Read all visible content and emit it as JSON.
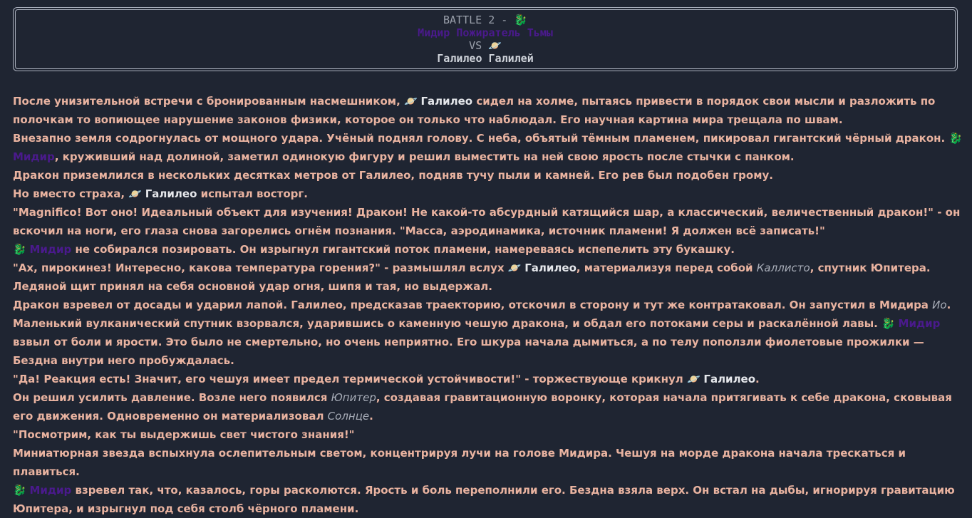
{
  "header": {
    "battle_label": "BATTLE 2 - ",
    "dragon_icon": "🐉",
    "fighter1": "Мидир Пожиратель Тьмы",
    "vs": "VS ",
    "planet_icon": "🪐",
    "fighter2": "Галилео Галилей"
  },
  "story": {
    "p1": [
      "После унизительной встречи с бронированным насмешником, ",
      "Галилео",
      " сидел на холме, пытаясь привести в порядок свои мысли и разложить по полочкам то вопиющее нарушение законов физики, которое он только что наблюдал. Его научная картина мира трещала по швам."
    ],
    "p2": [
      "Внезапно земля содрогнулась от мощного удара. Учёный поднял голову. С неба, объятый тёмным пламенем, пикировал гигантский чёрный дракон. ",
      "Мидир",
      ", круживший над долиной, заметил одинокую фигуру и решил выместить на ней свою ярость после стычки с панком."
    ],
    "p3": "Дракон приземлился в нескольких десятках метров от Галилео, подняв тучу пыли и камней. Его рев был подобен грому.",
    "p4": [
      "Но вместо страха, ",
      "Галилео",
      " испытал восторг."
    ],
    "p5": "\"Magnifico! Вот оно! Идеальный объект для изучения! Дракон! Не какой-то абсурдный катящийся шар, а классический, величественный дракон!\" - он вскочил на ноги, его глаза снова загорелись огнём познания. \"Масса, аэродинамика, источник пламени! Я должен всё записать!\"",
    "p6": [
      "Мидир",
      " не собирался позировать. Он изрыгнул гигантский поток пламени, намереваясь испепелить эту букашку."
    ],
    "p7": [
      "\"Ах, пирокинез! Интересно, какова температура горения?\" - размышлял вслух ",
      "Галилео",
      ", материализуя перед собой ",
      "Каллисто",
      ", спутник Юпитера. Ледяной щит принял на себя основной удар огня, шипя и тая, но выдержал."
    ],
    "p8": [
      "Дракон взревел от досады и ударил лапой. Галилео, предсказав траекторию, отскочил в сторону и тут же контратаковал. Он запустил в Мидира ",
      "Ио",
      ". Маленький вулканический спутник взорвался, ударившись о каменную чешую дракона, и обдал его потоками серы и раскалённой лавы. ",
      "Мидир",
      " взвыл от боли и ярости. Это было не смертельно, но очень неприятно. Его шкура начала дымиться, а по телу поползли фиолетовые прожилки — Бездна внутри него пробуждалась."
    ],
    "p9": [
      "\"Да! Реакция есть! Значит, его чешуя имеет предел термической устойчивости!\" - торжествующе крикнул ",
      "Галилео",
      "."
    ],
    "p10": [
      "Он решил усилить давление. Возле него появился ",
      "Юпитер",
      ", создавая гравитационную воронку, которая начала притягивать к себе дракона, сковывая его движения. Одновременно он материализовал ",
      "Солнце",
      "."
    ],
    "p11": "\"Посмотрим, как ты выдержишь свет чистого знания!\"",
    "p12": "Миниатюрная звезда вспыхнула ослепительным светом, концентрируя лучи на голове Мидира. Чешуя на морде дракона начала трескаться и плавиться.",
    "p13": [
      "Мидир",
      " взревел так, что, казалось, горы расколются. Ярость и боль переполнили его. Бездна взяла верх. Он встал на дыбы, игнорируя гравитацию Юпитера, и изрыгнул под себя столб чёрного пламени."
    ]
  },
  "colors": {
    "background": "#1f2532",
    "text": "#e9b3a0",
    "dragon_name": "#4a1a8c",
    "galileo_name": "#e5e7eb",
    "italic": "#a8adb8"
  }
}
